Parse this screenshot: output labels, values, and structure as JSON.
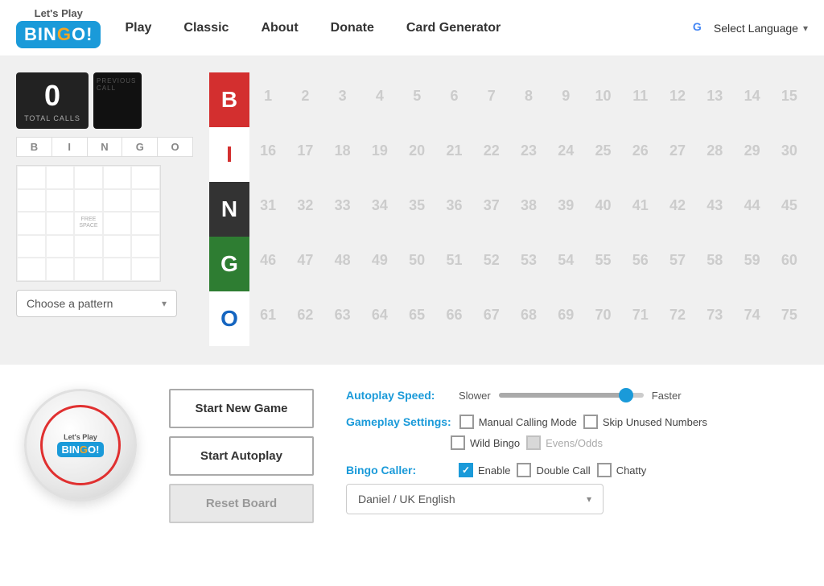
{
  "nav": {
    "logo_top": "Let's Play",
    "logo_main": "BINGO!",
    "links": [
      {
        "label": "Play",
        "id": "play"
      },
      {
        "label": "Classic",
        "id": "classic"
      },
      {
        "label": "About",
        "id": "about"
      },
      {
        "label": "Donate",
        "id": "donate"
      },
      {
        "label": "Card Generator",
        "id": "card-generator"
      }
    ],
    "language_label": "Select Language"
  },
  "game": {
    "total_calls": "0",
    "total_calls_label": "TOTAL CALLS",
    "previous_call_label": "PREVIOUS CALL",
    "bingo_letters": [
      "B",
      "I",
      "N",
      "G",
      "O"
    ],
    "bingo_vertical": [
      "B",
      "I",
      "N",
      "G",
      "O"
    ],
    "free_space_label": "FREE SPACE",
    "pattern_placeholder": "Choose a pattern",
    "numbers": [
      1,
      2,
      3,
      4,
      5,
      6,
      7,
      8,
      9,
      10,
      11,
      12,
      13,
      14,
      15,
      16,
      17,
      18,
      19,
      20,
      21,
      22,
      23,
      24,
      25,
      26,
      27,
      28,
      29,
      30,
      31,
      32,
      33,
      34,
      35,
      36,
      37,
      38,
      39,
      40,
      41,
      42,
      43,
      44,
      45,
      46,
      47,
      48,
      49,
      50,
      51,
      52,
      53,
      54,
      55,
      56,
      57,
      58,
      59,
      60,
      61,
      62,
      63,
      64,
      65,
      66,
      67,
      68,
      69,
      70,
      71,
      72,
      73,
      74,
      75
    ]
  },
  "buttons": {
    "start_new": "Start New Game",
    "start_auto": "Start Autoplay",
    "reset_board": "Reset Board"
  },
  "settings": {
    "autoplay_speed_label": "Autoplay Speed:",
    "slower_label": "Slower",
    "faster_label": "Faster",
    "gameplay_label": "Gameplay Settings:",
    "manual_calling": "Manual Calling Mode",
    "skip_unused": "Skip Unused Numbers",
    "wild_bingo": "Wild Bingo",
    "evens_odds": "Evens/Odds",
    "bingo_caller_label": "Bingo Caller:",
    "enable_label": "Enable",
    "double_call_label": "Double Call",
    "chatty_label": "Chatty",
    "caller_value": "Daniel / UK English"
  },
  "logo": {
    "top": "Let's Play",
    "main": "BINGO!"
  }
}
